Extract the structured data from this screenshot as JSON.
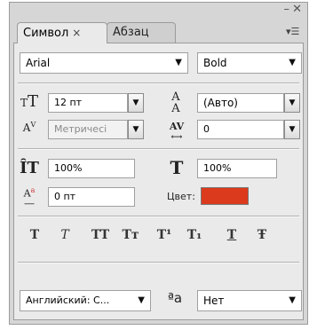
{
  "window": {
    "minimize_glyph": "–",
    "close_glyph": "✕"
  },
  "tabs": [
    {
      "label": "Символ",
      "close": "×",
      "active": true
    },
    {
      "label": "Абзац",
      "active": false
    }
  ],
  "panel_menu_glyph": "▾☰",
  "font": {
    "family": "Arial",
    "style": "Bold"
  },
  "size": {
    "value": "12 пт",
    "icon": "font-size-icon"
  },
  "leading": {
    "value": "(Авто)",
    "icon": "leading-icon"
  },
  "kerning": {
    "value": "Метричесі",
    "icon": "kerning-icon"
  },
  "tracking": {
    "value": "0",
    "icon": "tracking-icon"
  },
  "vertical_scale": {
    "value": "100%",
    "icon": "vertical-scale-icon"
  },
  "horizontal_scale": {
    "value": "100%",
    "icon": "horizontal-scale-icon"
  },
  "baseline_shift": {
    "value": "0 пт",
    "icon": "baseline-shift-icon"
  },
  "color": {
    "label": "Цвет:",
    "swatch": "#dc3a1c"
  },
  "style_buttons": [
    {
      "name": "faux-bold",
      "glyph": "T"
    },
    {
      "name": "faux-italic",
      "glyph": "T"
    },
    {
      "name": "all-caps",
      "glyph": "TT"
    },
    {
      "name": "small-caps",
      "glyph": "Tт"
    },
    {
      "name": "superscript",
      "glyph": "T¹"
    },
    {
      "name": "subscript",
      "glyph": "T₁"
    },
    {
      "name": "underline",
      "glyph": "T"
    },
    {
      "name": "strikethrough",
      "glyph": "Ŧ"
    }
  ],
  "language": {
    "value": "Английский: С..."
  },
  "antialias": {
    "icon_text": "ªa",
    "value": "Нет"
  },
  "caret": "▼"
}
